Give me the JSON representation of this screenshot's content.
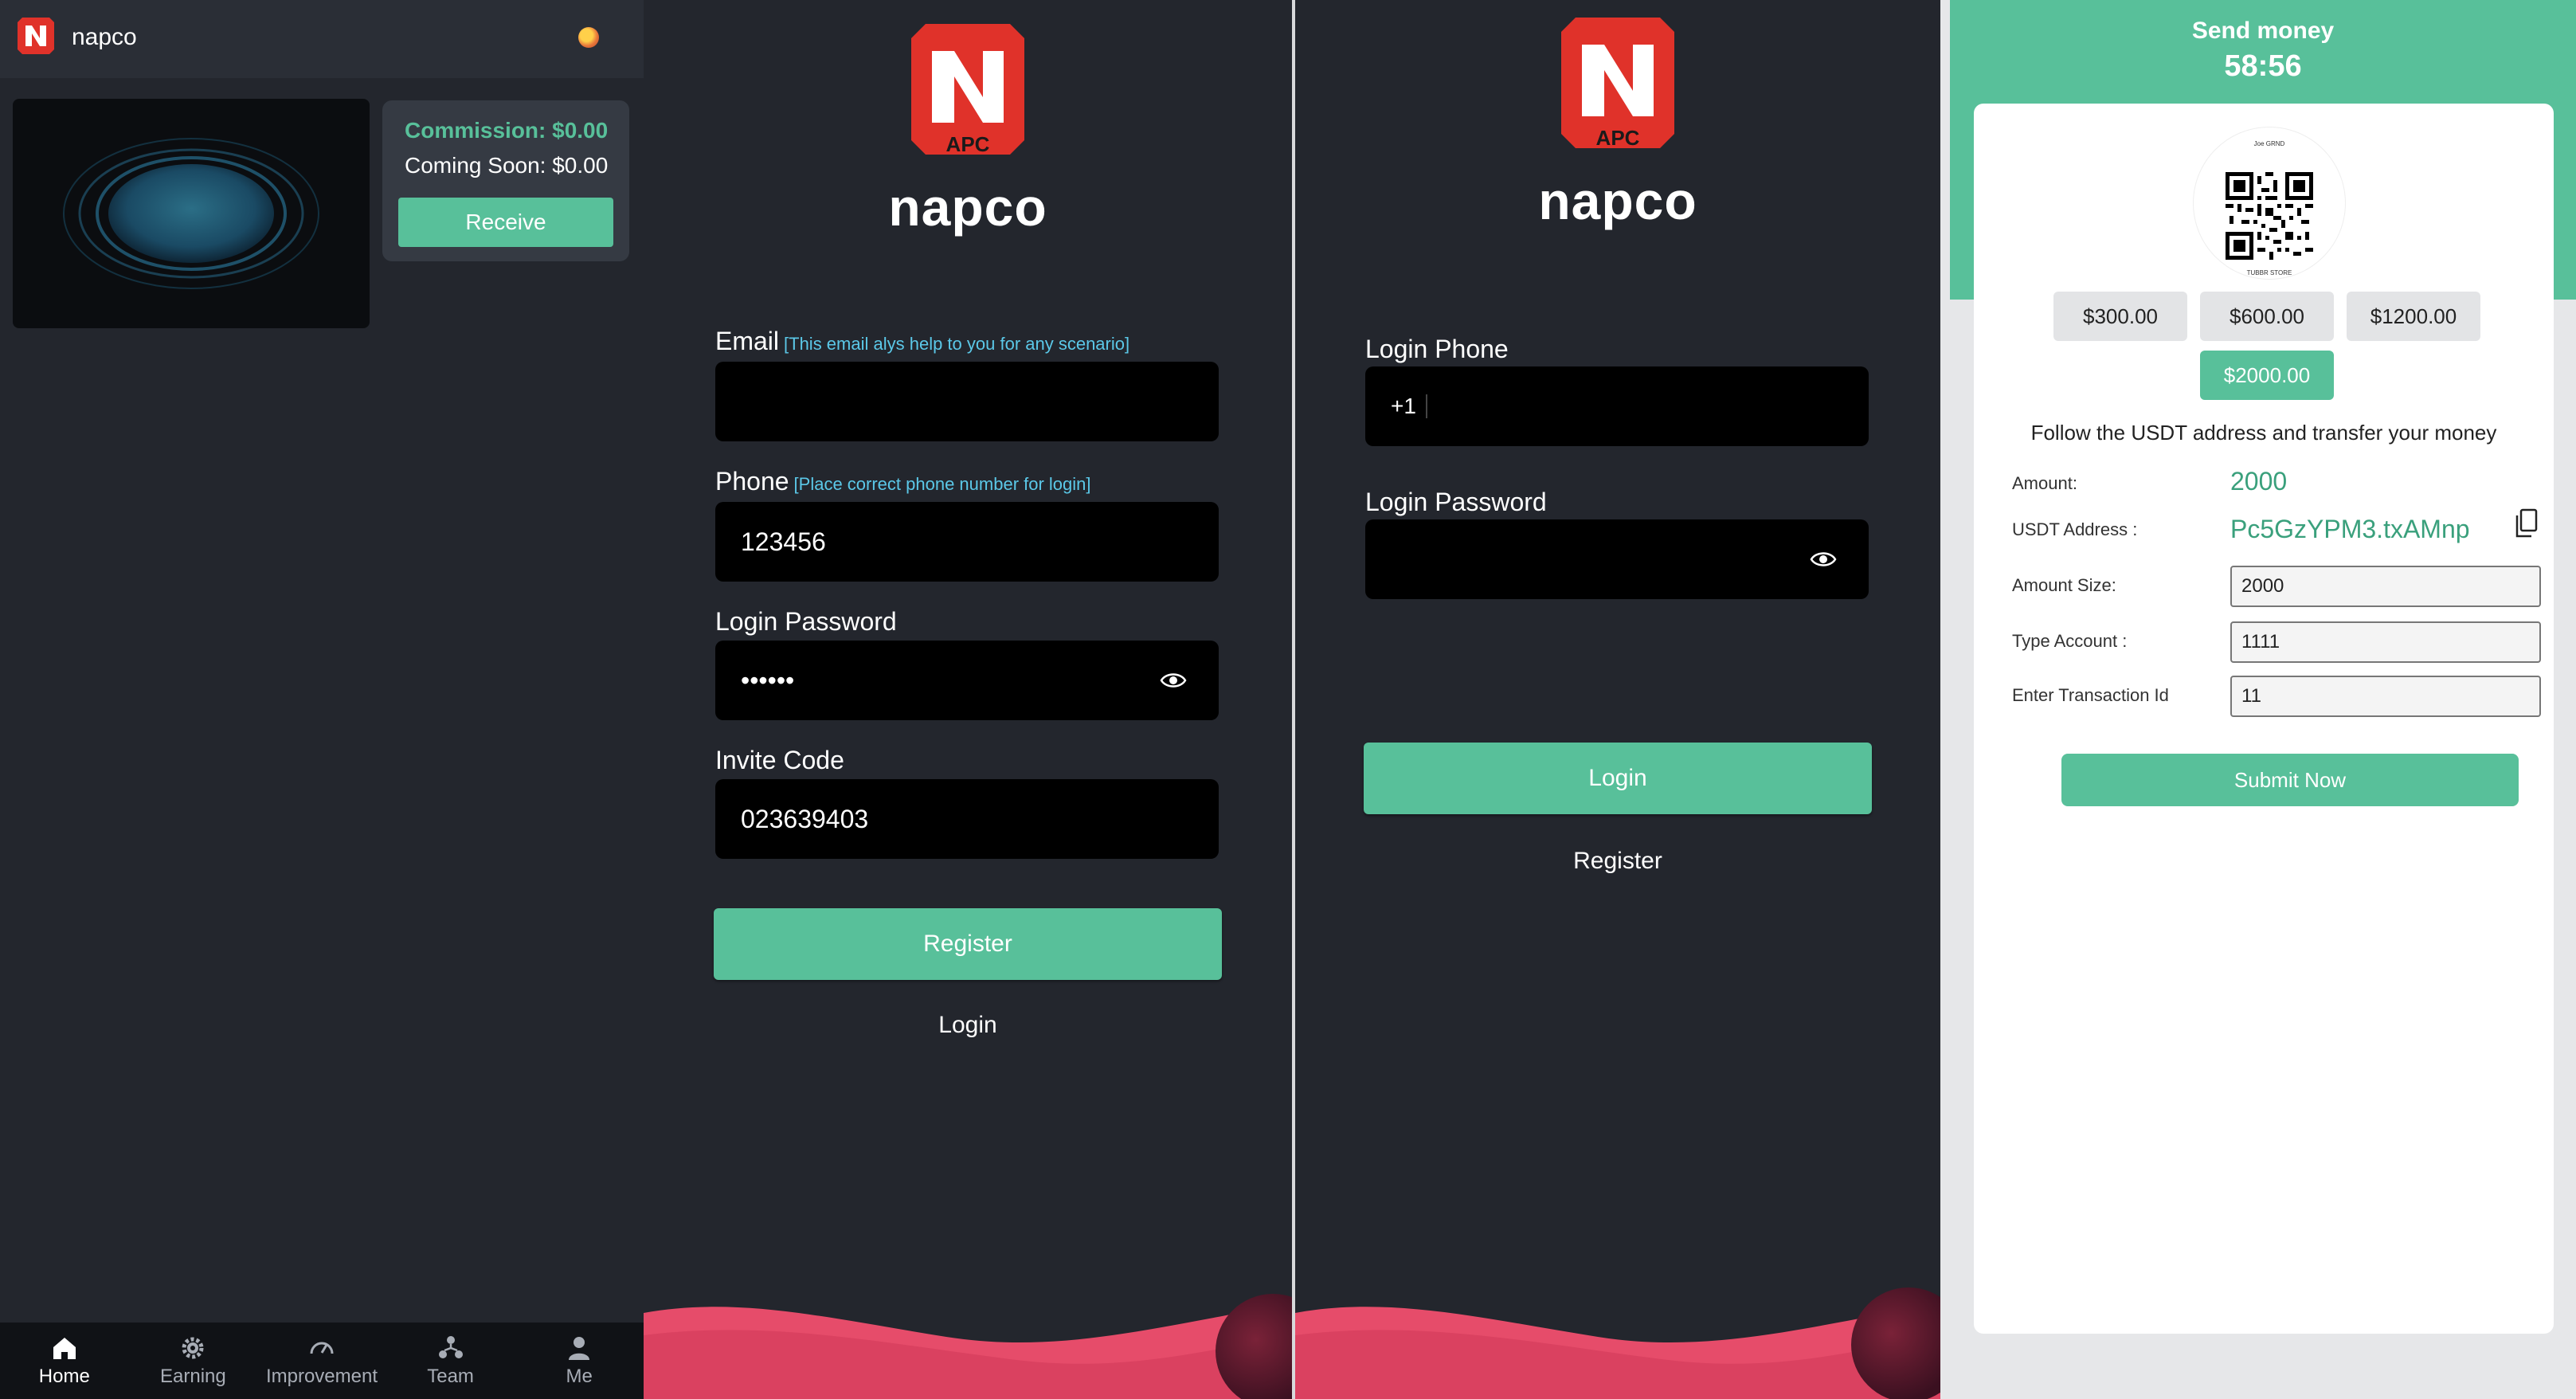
{
  "colors": {
    "accent": "#58c09a",
    "dark_bg": "#23262d",
    "hint": "#5bc8e8",
    "brand_red": "#e0322a",
    "wave": "#e64c6a"
  },
  "home": {
    "app_name": "napco",
    "commission": "Commission: $0.00",
    "coming_soon": "Coming Soon: $0.00",
    "receive_label": "Receive",
    "nav": [
      {
        "label": "Home",
        "icon": "home-icon"
      },
      {
        "label": "Earning",
        "icon": "gear-icon"
      },
      {
        "label": "Improvement",
        "icon": "gauge-icon"
      },
      {
        "label": "Team",
        "icon": "team-icon"
      },
      {
        "label": "Me",
        "icon": "user-icon"
      }
    ]
  },
  "register": {
    "brand": "napco",
    "email_label": "Email",
    "email_hint": "[This email alys help to you for any scenario]",
    "email_value": "",
    "phone_label": "Phone",
    "phone_hint": "[Place correct phone number for login]",
    "phone_value": "123456",
    "password_label": "Login Password",
    "password_value": "••••••",
    "invite_label": "Invite Code",
    "invite_value": "023639403",
    "register_button": "Register",
    "login_link": "Login"
  },
  "login": {
    "brand": "napco",
    "phone_label": "Login Phone",
    "phone_prefix": "+1",
    "password_label": "Login Password",
    "login_button": "Login",
    "register_link": "Register"
  },
  "send_money": {
    "title": "Send money",
    "timer": "58:56",
    "qr_header": "Joe GRND",
    "qr_caption": "TUBBR STORE",
    "amount_options": [
      "$300.00",
      "$600.00",
      "$1200.00",
      "$2000.00"
    ],
    "selected_amount": "$2000.00",
    "instruction": "Follow the USDT address and transfer your money",
    "amount_label": "Amount:",
    "amount_value": "2000",
    "usdt_label": "USDT Address :",
    "usdt_value": "Pc5GzYPM3.txAMnp",
    "amount_size_label": "Amount Size:",
    "amount_size_value": "2000",
    "type_account_label": "Type Account :",
    "type_account_value": "1111",
    "txid_label": "Enter Transaction Id",
    "txid_value": "11",
    "submit_label": "Submit Now"
  }
}
